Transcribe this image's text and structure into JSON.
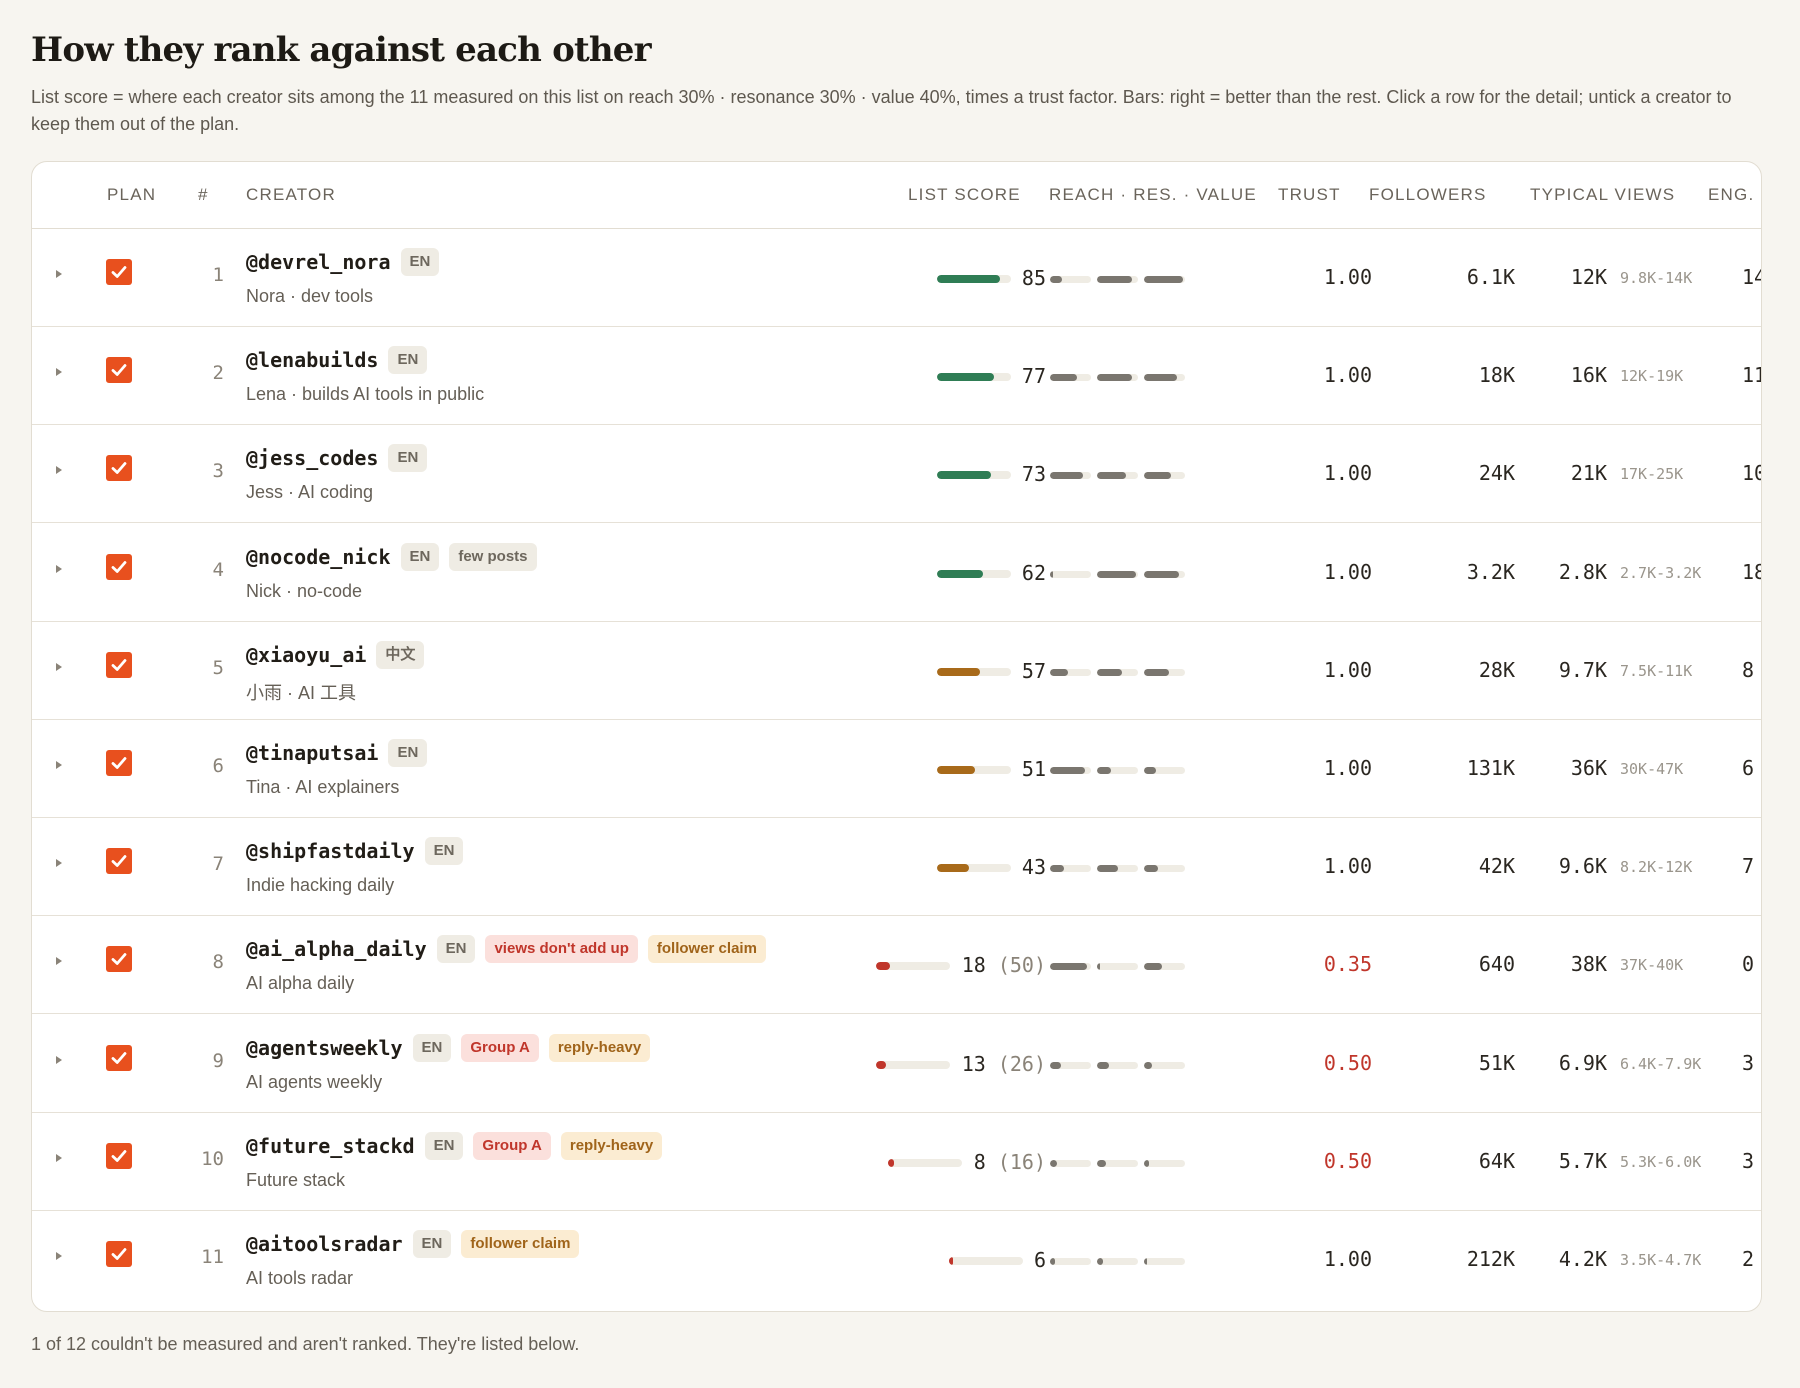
{
  "title": "How they rank against each other",
  "description": "List score = where each creator sits among the 11 measured on this list on reach 30% · resonance 30% · value 40%, times a trust factor. Bars: right = better than the rest. Click a row for the detail; untick a creator to keep them out of the plan.",
  "columns": {
    "plan": "PLAN",
    "rank": "#",
    "creator": "CREATOR",
    "list_score": "LIST SCORE",
    "metrics": "REACH · RES. · VALUE",
    "trust": "TRUST",
    "followers": "FOLLOWERS",
    "typical_views": "TYPICAL VIEWS",
    "eng": "ENG."
  },
  "colors": {
    "accent": "#e8501e",
    "score_high": "#2f7d55",
    "score_mid": "#a86a1a",
    "score_low": "#c0362b",
    "metric": "#7a766f",
    "tag_red": "#fbe0dc",
    "tag_amber": "#fbecd2"
  },
  "rows": [
    {
      "rank": "1",
      "handle": "@devrel_nora",
      "subtitle": "Nora · dev tools",
      "tags": [
        {
          "text": "EN",
          "kind": "lang"
        }
      ],
      "score": "85",
      "raw": "",
      "score_frac": 0.85,
      "score_color": "high",
      "reach": 0.3,
      "res": 0.85,
      "value": 0.95,
      "trust": "1.00",
      "trust_low": false,
      "followers": "6.1K",
      "views": "12K",
      "range": "9.8K-14K",
      "eng": "14",
      "plan_checked": true
    },
    {
      "rank": "2",
      "handle": "@lenabuilds",
      "subtitle": "Lena · builds AI tools in public",
      "tags": [
        {
          "text": "EN",
          "kind": "lang"
        }
      ],
      "score": "77",
      "raw": "",
      "score_frac": 0.77,
      "score_color": "high",
      "reach": 0.65,
      "res": 0.85,
      "value": 0.8,
      "trust": "1.00",
      "trust_low": false,
      "followers": "18K",
      "views": "16K",
      "range": "12K-19K",
      "eng": "11",
      "plan_checked": true
    },
    {
      "rank": "3",
      "handle": "@jess_codes",
      "subtitle": "Jess · AI coding",
      "tags": [
        {
          "text": "EN",
          "kind": "lang"
        }
      ],
      "score": "73",
      "raw": "",
      "score_frac": 0.73,
      "score_color": "high",
      "reach": 0.8,
      "res": 0.7,
      "value": 0.65,
      "trust": "1.00",
      "trust_low": false,
      "followers": "24K",
      "views": "21K",
      "range": "17K-25K",
      "eng": "10",
      "plan_checked": true
    },
    {
      "rank": "4",
      "handle": "@nocode_nick",
      "subtitle": "Nick · no-code",
      "tags": [
        {
          "text": "EN",
          "kind": "lang"
        },
        {
          "text": "few posts",
          "kind": "neutral"
        }
      ],
      "score": "62",
      "raw": "",
      "score_frac": 0.63,
      "score_color": "high",
      "reach": 0.0,
      "res": 0.95,
      "value": 0.85,
      "trust": "1.00",
      "trust_low": false,
      "followers": "3.2K",
      "views": "2.8K",
      "range": "2.7K-3.2K",
      "eng": "18",
      "plan_checked": true
    },
    {
      "rank": "5",
      "handle": "@xiaoyu_ai",
      "subtitle": "小雨 · AI 工具",
      "tags": [
        {
          "text": "中文",
          "kind": "lang"
        }
      ],
      "score": "57",
      "raw": "",
      "score_frac": 0.58,
      "score_color": "mid",
      "reach": 0.45,
      "res": 0.6,
      "value": 0.6,
      "trust": "1.00",
      "trust_low": false,
      "followers": "28K",
      "views": "9.7K",
      "range": "7.5K-11K",
      "eng": "8",
      "plan_checked": true
    },
    {
      "rank": "6",
      "handle": "@tinaputsai",
      "subtitle": "Tina · AI explainers",
      "tags": [
        {
          "text": "EN",
          "kind": "lang"
        }
      ],
      "score": "51",
      "raw": "",
      "score_frac": 0.52,
      "score_color": "mid",
      "reach": 0.85,
      "res": 0.35,
      "value": 0.3,
      "trust": "1.00",
      "trust_low": false,
      "followers": "131K",
      "views": "36K",
      "range": "30K-47K",
      "eng": "6",
      "plan_checked": true
    },
    {
      "rank": "7",
      "handle": "@shipfastdaily",
      "subtitle": "Indie hacking daily",
      "tags": [
        {
          "text": "EN",
          "kind": "lang"
        }
      ],
      "score": "43",
      "raw": "",
      "score_frac": 0.44,
      "score_color": "mid",
      "reach": 0.35,
      "res": 0.5,
      "value": 0.35,
      "trust": "1.00",
      "trust_low": false,
      "followers": "42K",
      "views": "9.6K",
      "range": "8.2K-12K",
      "eng": "7",
      "plan_checked": true
    },
    {
      "rank": "8",
      "handle": "@ai_alpha_daily",
      "subtitle": "AI alpha daily",
      "tags": [
        {
          "text": "EN",
          "kind": "lang"
        },
        {
          "text": "views don't add up",
          "kind": "red"
        },
        {
          "text": "follower claim",
          "kind": "amber"
        }
      ],
      "score": "18",
      "raw": "(50)",
      "score_frac": 0.18,
      "score_color": "low",
      "reach": 0.9,
      "res": 0.0,
      "value": 0.45,
      "trust": "0.35",
      "trust_low": true,
      "followers": "640",
      "views": "38K",
      "range": "37K-40K",
      "eng": "0",
      "plan_checked": true
    },
    {
      "rank": "9",
      "handle": "@agentsweekly",
      "subtitle": "AI agents weekly",
      "tags": [
        {
          "text": "EN",
          "kind": "lang"
        },
        {
          "text": "Group A",
          "kind": "red"
        },
        {
          "text": "reply-heavy",
          "kind": "amber"
        }
      ],
      "score": "13",
      "raw": "(26)",
      "score_frac": 0.13,
      "score_color": "low",
      "reach": 0.28,
      "res": 0.3,
      "value": 0.2,
      "trust": "0.50",
      "trust_low": true,
      "followers": "51K",
      "views": "6.9K",
      "range": "6.4K-7.9K",
      "eng": "3",
      "plan_checked": true
    },
    {
      "rank": "10",
      "handle": "@future_stackd",
      "subtitle": "Future stack",
      "tags": [
        {
          "text": "EN",
          "kind": "lang"
        },
        {
          "text": "Group A",
          "kind": "red"
        },
        {
          "text": "reply-heavy",
          "kind": "amber"
        }
      ],
      "score": "8",
      "raw": "(16)",
      "score_frac": 0.08,
      "score_color": "low",
      "reach": 0.18,
      "res": 0.22,
      "value": 0.12,
      "trust": "0.50",
      "trust_low": true,
      "followers": "64K",
      "views": "5.7K",
      "range": "5.3K-6.0K",
      "eng": "3",
      "plan_checked": true
    },
    {
      "rank": "11",
      "handle": "@aitoolsradar",
      "subtitle": "AI tools radar",
      "tags": [
        {
          "text": "EN",
          "kind": "lang"
        },
        {
          "text": "follower claim",
          "kind": "amber"
        }
      ],
      "score": "6",
      "raw": "",
      "score_frac": 0.06,
      "score_color": "low",
      "reach": 0.12,
      "res": 0.15,
      "value": 0.0,
      "trust": "1.00",
      "trust_low": false,
      "followers": "212K",
      "views": "4.2K",
      "range": "3.5K-4.7K",
      "eng": "2",
      "plan_checked": true
    }
  ],
  "footnote": "1 of 12 couldn't be measured and aren't ranked. They're listed below."
}
